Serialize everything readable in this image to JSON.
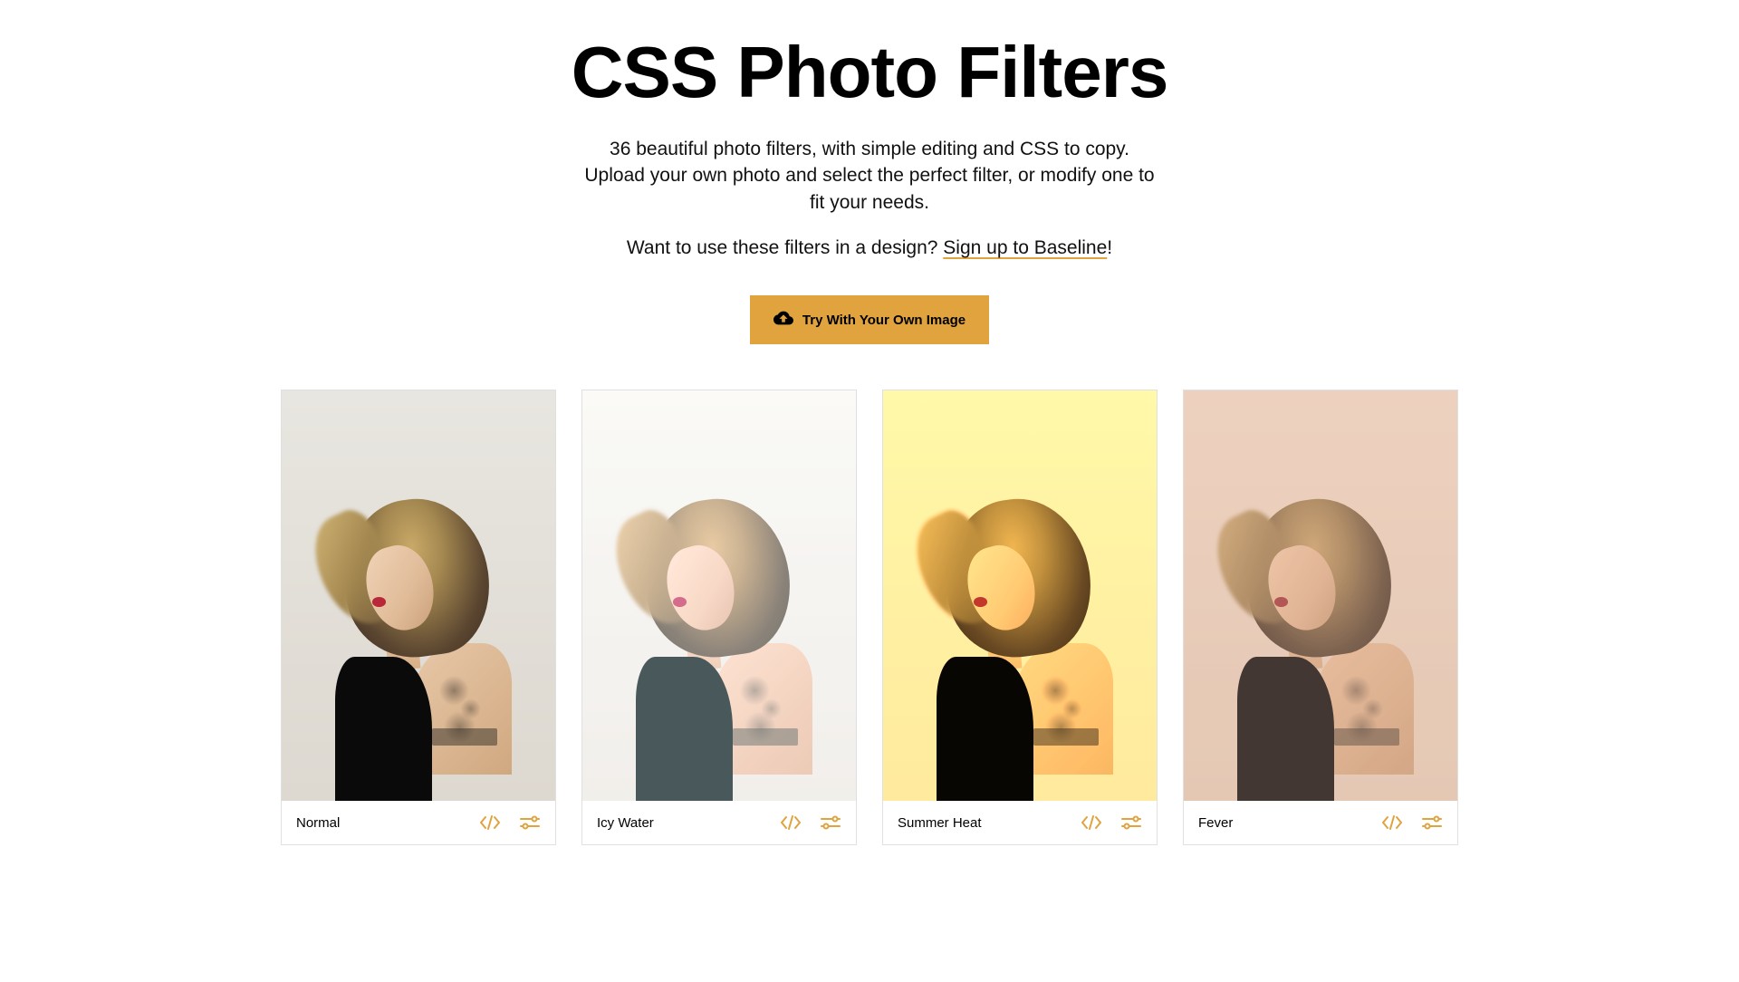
{
  "header": {
    "title": "CSS Photo Filters",
    "description": "36 beautiful photo filters, with simple editing and CSS to copy. Upload your own photo and select the perfect filter, or modify one to fit your needs.",
    "tagline_prefix": "Want to use these filters in a design? ",
    "tagline_link": "Sign up to Baseline",
    "tagline_suffix": "!",
    "upload_button": "Try With Your Own Image"
  },
  "filters": [
    {
      "name": "Normal",
      "filter_class": "filter-normal"
    },
    {
      "name": "Icy Water",
      "filter_class": "filter-icy-water"
    },
    {
      "name": "Summer Heat",
      "filter_class": "filter-summer-heat"
    },
    {
      "name": "Fever",
      "filter_class": "filter-fever"
    }
  ],
  "colors": {
    "accent": "#e0a33e"
  }
}
